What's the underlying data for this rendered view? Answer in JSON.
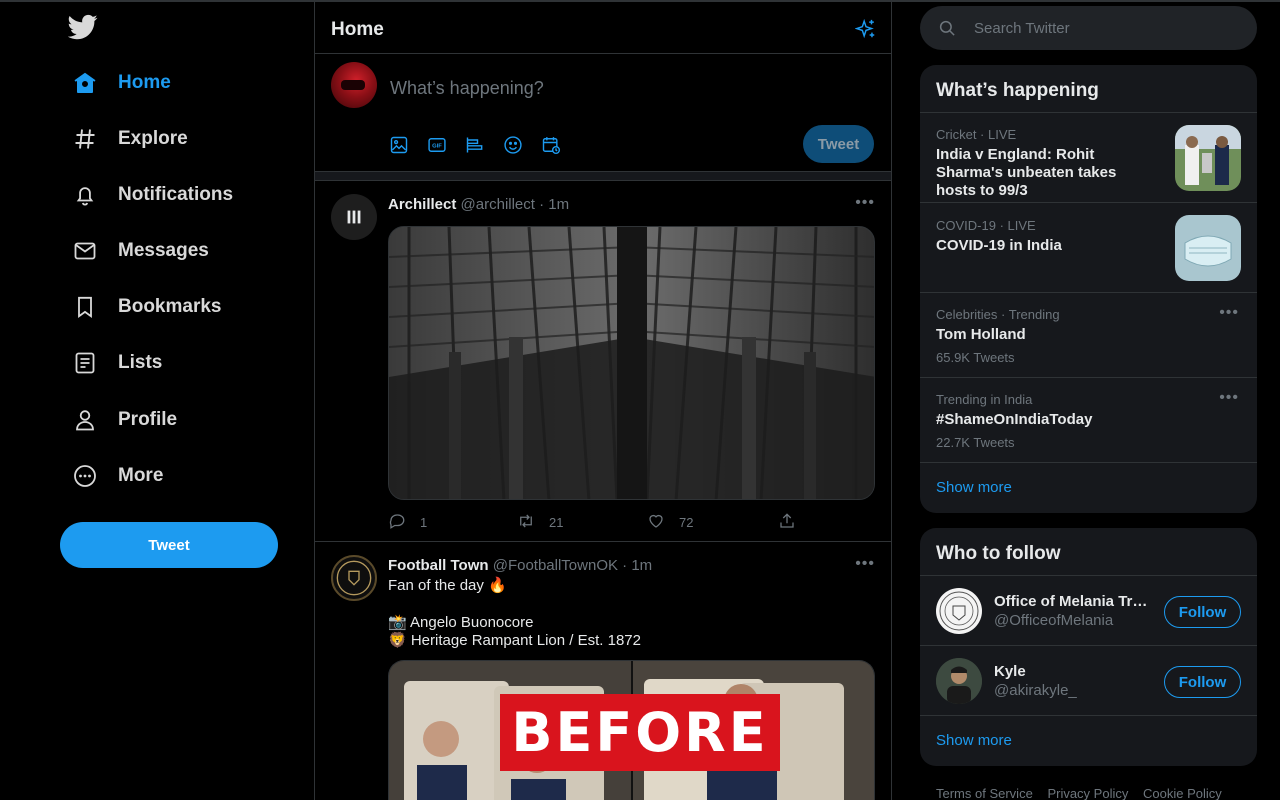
{
  "nav": {
    "items": [
      {
        "label": "Home",
        "icon": "home-icon"
      },
      {
        "label": "Explore",
        "icon": "hashtag-icon"
      },
      {
        "label": "Notifications",
        "icon": "bell-icon"
      },
      {
        "label": "Messages",
        "icon": "mail-icon"
      },
      {
        "label": "Bookmarks",
        "icon": "bookmark-icon"
      },
      {
        "label": "Lists",
        "icon": "list-icon"
      },
      {
        "label": "Profile",
        "icon": "person-icon"
      },
      {
        "label": "More",
        "icon": "more-circle-icon"
      }
    ],
    "tweet_button": "Tweet"
  },
  "header": {
    "title": "Home"
  },
  "composer": {
    "placeholder": "What’s happening?",
    "tweet_button": "Tweet"
  },
  "tweets": [
    {
      "name": "Archillect",
      "handle": "@archillect",
      "time": "1m",
      "replies": "1",
      "retweets": "21",
      "likes": "72"
    },
    {
      "name": "Football Town",
      "handle": "@FootballTownOK",
      "time": "1m",
      "line1": "Fan of the day 🔥",
      "line2": "📸 Angelo Buonocore",
      "line3": "🦁 Heritage Rampant Lion / Est. 1872"
    }
  ],
  "search": {
    "placeholder": "Search Twitter"
  },
  "whats_happening": {
    "title": "What’s happening",
    "trends": [
      {
        "meta": "Cricket · LIVE",
        "title": "India v England: Rohit Sharma's unbeaten takes hosts to 99/3"
      },
      {
        "meta": "COVID-19 · LIVE",
        "title": "COVID-19 in India"
      },
      {
        "meta": "Celebrities · Trending",
        "title": "Tom Holland",
        "count": "65.9K Tweets"
      },
      {
        "meta": "Trending in India",
        "title": "#ShameOnIndiaToday",
        "count": "22.7K Tweets"
      }
    ],
    "show_more": "Show more"
  },
  "who_to_follow": {
    "title": "Who to follow",
    "accounts": [
      {
        "name": "Office of Melania Trump",
        "handle": "@OfficeofMelania",
        "button": "Follow"
      },
      {
        "name": "Kyle",
        "handle": "@akirakyle_",
        "button": "Follow"
      }
    ],
    "show_more": "Show more"
  },
  "footer": {
    "links": [
      "Terms of Service",
      "Privacy Policy",
      "Cookie Policy"
    ]
  },
  "overlay": {
    "badge": "BEFORE"
  },
  "colors": {
    "accent": "#1d9bf0",
    "background": "#000000",
    "panel": "#16181c",
    "badge": "#d9141d"
  }
}
